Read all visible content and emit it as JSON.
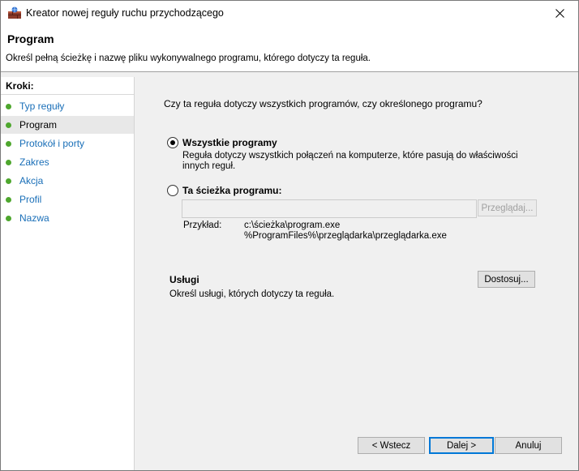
{
  "window": {
    "title": "Kreator nowej reguły ruchu przychodzącego",
    "icon": "firewall-app-icon"
  },
  "header": {
    "title": "Program",
    "description": "Określ pełną ścieżkę i nazwę pliku wykonywalnego programu, którego dotyczy ta reguła."
  },
  "steps": {
    "heading": "Kroki:",
    "items": [
      {
        "label": "Typ reguły",
        "current": false
      },
      {
        "label": "Program",
        "current": true
      },
      {
        "label": "Protokół i porty",
        "current": false
      },
      {
        "label": "Zakres",
        "current": false
      },
      {
        "label": "Akcja",
        "current": false
      },
      {
        "label": "Profil",
        "current": false
      },
      {
        "label": "Nazwa",
        "current": false
      }
    ]
  },
  "main": {
    "question": "Czy ta reguła dotyczy wszystkich programów, czy określonego programu?",
    "all_programs": {
      "label": "Wszystkie programy",
      "description": "Reguła dotyczy wszystkich połączeń na komputerze, które pasują do właściwości innych reguł.",
      "selected": true
    },
    "program_path": {
      "label": "Ta ścieżka programu:",
      "value": "",
      "selected": false,
      "browse_label": "Przeglądaj..."
    },
    "example": {
      "label": "Przykład:",
      "line1": "c:\\ścieżka\\program.exe",
      "line2": "%ProgramFiles%\\przeglądarka\\przeglądarka.exe"
    },
    "services": {
      "title": "Usługi",
      "description": "Określ usługi, których dotyczy ta reguła.",
      "customize_label": "Dostosuj..."
    }
  },
  "footer": {
    "back_label": "< Wstecz",
    "next_label": "Dalej >",
    "cancel_label": "Anuluj"
  },
  "colors": {
    "step_dot": "#4ea72e",
    "step_link": "#1a6fb8",
    "default_button_border": "#0078d7"
  }
}
